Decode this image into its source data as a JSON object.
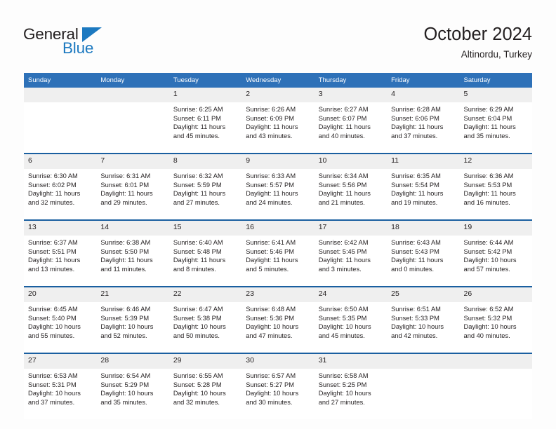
{
  "logo": {
    "word1": "General",
    "word2": "Blue",
    "triangle_color": "#1c79c0",
    "text_color": "#231f20"
  },
  "header": {
    "title": "October 2024",
    "location": "Altinordu, Turkey"
  },
  "theme": {
    "header_blue": "#2e71b8",
    "rule_blue": "#1a5fa0",
    "band_gray": "#efefef",
    "text": "#231f20",
    "cell_white": "#ffffff"
  },
  "columns": [
    "Sunday",
    "Monday",
    "Tuesday",
    "Wednesday",
    "Thursday",
    "Friday",
    "Saturday"
  ],
  "weeks": [
    {
      "days": [
        {
          "num": "",
          "sunrise": "",
          "sunset": "",
          "daylight1": "",
          "daylight2": ""
        },
        {
          "num": "",
          "sunrise": "",
          "sunset": "",
          "daylight1": "",
          "daylight2": ""
        },
        {
          "num": "1",
          "sunrise": "Sunrise: 6:25 AM",
          "sunset": "Sunset: 6:11 PM",
          "daylight1": "Daylight: 11 hours",
          "daylight2": "and 45 minutes."
        },
        {
          "num": "2",
          "sunrise": "Sunrise: 6:26 AM",
          "sunset": "Sunset: 6:09 PM",
          "daylight1": "Daylight: 11 hours",
          "daylight2": "and 43 minutes."
        },
        {
          "num": "3",
          "sunrise": "Sunrise: 6:27 AM",
          "sunset": "Sunset: 6:07 PM",
          "daylight1": "Daylight: 11 hours",
          "daylight2": "and 40 minutes."
        },
        {
          "num": "4",
          "sunrise": "Sunrise: 6:28 AM",
          "sunset": "Sunset: 6:06 PM",
          "daylight1": "Daylight: 11 hours",
          "daylight2": "and 37 minutes."
        },
        {
          "num": "5",
          "sunrise": "Sunrise: 6:29 AM",
          "sunset": "Sunset: 6:04 PM",
          "daylight1": "Daylight: 11 hours",
          "daylight2": "and 35 minutes."
        }
      ]
    },
    {
      "days": [
        {
          "num": "6",
          "sunrise": "Sunrise: 6:30 AM",
          "sunset": "Sunset: 6:02 PM",
          "daylight1": "Daylight: 11 hours",
          "daylight2": "and 32 minutes."
        },
        {
          "num": "7",
          "sunrise": "Sunrise: 6:31 AM",
          "sunset": "Sunset: 6:01 PM",
          "daylight1": "Daylight: 11 hours",
          "daylight2": "and 29 minutes."
        },
        {
          "num": "8",
          "sunrise": "Sunrise: 6:32 AM",
          "sunset": "Sunset: 5:59 PM",
          "daylight1": "Daylight: 11 hours",
          "daylight2": "and 27 minutes."
        },
        {
          "num": "9",
          "sunrise": "Sunrise: 6:33 AM",
          "sunset": "Sunset: 5:57 PM",
          "daylight1": "Daylight: 11 hours",
          "daylight2": "and 24 minutes."
        },
        {
          "num": "10",
          "sunrise": "Sunrise: 6:34 AM",
          "sunset": "Sunset: 5:56 PM",
          "daylight1": "Daylight: 11 hours",
          "daylight2": "and 21 minutes."
        },
        {
          "num": "11",
          "sunrise": "Sunrise: 6:35 AM",
          "sunset": "Sunset: 5:54 PM",
          "daylight1": "Daylight: 11 hours",
          "daylight2": "and 19 minutes."
        },
        {
          "num": "12",
          "sunrise": "Sunrise: 6:36 AM",
          "sunset": "Sunset: 5:53 PM",
          "daylight1": "Daylight: 11 hours",
          "daylight2": "and 16 minutes."
        }
      ]
    },
    {
      "days": [
        {
          "num": "13",
          "sunrise": "Sunrise: 6:37 AM",
          "sunset": "Sunset: 5:51 PM",
          "daylight1": "Daylight: 11 hours",
          "daylight2": "and 13 minutes."
        },
        {
          "num": "14",
          "sunrise": "Sunrise: 6:38 AM",
          "sunset": "Sunset: 5:50 PM",
          "daylight1": "Daylight: 11 hours",
          "daylight2": "and 11 minutes."
        },
        {
          "num": "15",
          "sunrise": "Sunrise: 6:40 AM",
          "sunset": "Sunset: 5:48 PM",
          "daylight1": "Daylight: 11 hours",
          "daylight2": "and 8 minutes."
        },
        {
          "num": "16",
          "sunrise": "Sunrise: 6:41 AM",
          "sunset": "Sunset: 5:46 PM",
          "daylight1": "Daylight: 11 hours",
          "daylight2": "and 5 minutes."
        },
        {
          "num": "17",
          "sunrise": "Sunrise: 6:42 AM",
          "sunset": "Sunset: 5:45 PM",
          "daylight1": "Daylight: 11 hours",
          "daylight2": "and 3 minutes."
        },
        {
          "num": "18",
          "sunrise": "Sunrise: 6:43 AM",
          "sunset": "Sunset: 5:43 PM",
          "daylight1": "Daylight: 11 hours",
          "daylight2": "and 0 minutes."
        },
        {
          "num": "19",
          "sunrise": "Sunrise: 6:44 AM",
          "sunset": "Sunset: 5:42 PM",
          "daylight1": "Daylight: 10 hours",
          "daylight2": "and 57 minutes."
        }
      ]
    },
    {
      "days": [
        {
          "num": "20",
          "sunrise": "Sunrise: 6:45 AM",
          "sunset": "Sunset: 5:40 PM",
          "daylight1": "Daylight: 10 hours",
          "daylight2": "and 55 minutes."
        },
        {
          "num": "21",
          "sunrise": "Sunrise: 6:46 AM",
          "sunset": "Sunset: 5:39 PM",
          "daylight1": "Daylight: 10 hours",
          "daylight2": "and 52 minutes."
        },
        {
          "num": "22",
          "sunrise": "Sunrise: 6:47 AM",
          "sunset": "Sunset: 5:38 PM",
          "daylight1": "Daylight: 10 hours",
          "daylight2": "and 50 minutes."
        },
        {
          "num": "23",
          "sunrise": "Sunrise: 6:48 AM",
          "sunset": "Sunset: 5:36 PM",
          "daylight1": "Daylight: 10 hours",
          "daylight2": "and 47 minutes."
        },
        {
          "num": "24",
          "sunrise": "Sunrise: 6:50 AM",
          "sunset": "Sunset: 5:35 PM",
          "daylight1": "Daylight: 10 hours",
          "daylight2": "and 45 minutes."
        },
        {
          "num": "25",
          "sunrise": "Sunrise: 6:51 AM",
          "sunset": "Sunset: 5:33 PM",
          "daylight1": "Daylight: 10 hours",
          "daylight2": "and 42 minutes."
        },
        {
          "num": "26",
          "sunrise": "Sunrise: 6:52 AM",
          "sunset": "Sunset: 5:32 PM",
          "daylight1": "Daylight: 10 hours",
          "daylight2": "and 40 minutes."
        }
      ]
    },
    {
      "days": [
        {
          "num": "27",
          "sunrise": "Sunrise: 6:53 AM",
          "sunset": "Sunset: 5:31 PM",
          "daylight1": "Daylight: 10 hours",
          "daylight2": "and 37 minutes."
        },
        {
          "num": "28",
          "sunrise": "Sunrise: 6:54 AM",
          "sunset": "Sunset: 5:29 PM",
          "daylight1": "Daylight: 10 hours",
          "daylight2": "and 35 minutes."
        },
        {
          "num": "29",
          "sunrise": "Sunrise: 6:55 AM",
          "sunset": "Sunset: 5:28 PM",
          "daylight1": "Daylight: 10 hours",
          "daylight2": "and 32 minutes."
        },
        {
          "num": "30",
          "sunrise": "Sunrise: 6:57 AM",
          "sunset": "Sunset: 5:27 PM",
          "daylight1": "Daylight: 10 hours",
          "daylight2": "and 30 minutes."
        },
        {
          "num": "31",
          "sunrise": "Sunrise: 6:58 AM",
          "sunset": "Sunset: 5:25 PM",
          "daylight1": "Daylight: 10 hours",
          "daylight2": "and 27 minutes."
        },
        {
          "num": "",
          "sunrise": "",
          "sunset": "",
          "daylight1": "",
          "daylight2": ""
        },
        {
          "num": "",
          "sunrise": "",
          "sunset": "",
          "daylight1": "",
          "daylight2": ""
        }
      ]
    }
  ]
}
